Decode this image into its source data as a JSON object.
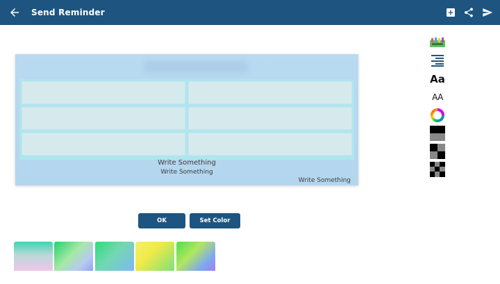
{
  "appbar": {
    "title": "Send Reminder",
    "back_icon": "arrow-left-icon",
    "actions": [
      "add-box-icon",
      "share-icon",
      "send-icon"
    ],
    "color": "#1d5580"
  },
  "preview": {
    "caption_1": "Write Something",
    "caption_2": "Write Something",
    "caption_3": "Write Something",
    "grid_rows": 3,
    "grid_cols": 2
  },
  "toolbar": {
    "items": [
      "sticker-icon",
      "align-right-icon",
      "font-style",
      "font-size",
      "color-wheel-icon",
      "pattern-1",
      "pattern-2",
      "pattern-3"
    ],
    "font_style_label": "Aa",
    "font_size_label": "AA"
  },
  "buttons": {
    "ok_label": "OK",
    "set_color_label": "Set Color"
  },
  "swatches": [
    "teal-pink-gradient",
    "green-blue-gradient",
    "green-blue-gradient-2",
    "yellow-green-gradient",
    "green-blue-purple-gradient"
  ]
}
